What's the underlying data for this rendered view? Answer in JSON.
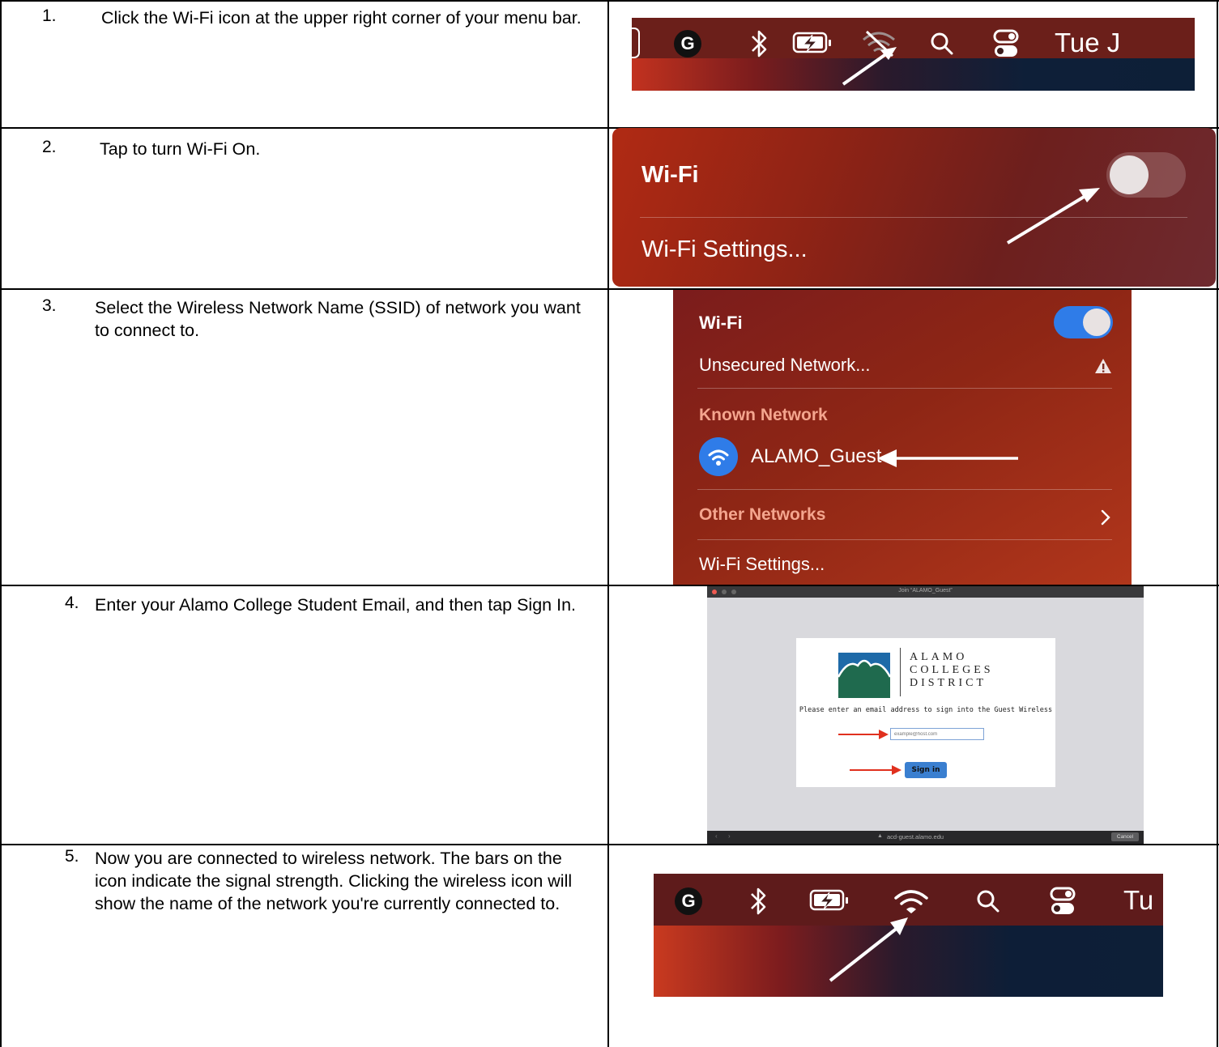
{
  "steps": [
    {
      "num": "1.",
      "text": "Click the Wi-Fi icon at the upper right corner of your menu bar."
    },
    {
      "num": "2.",
      "text": "Tap to turn Wi-Fi On."
    },
    {
      "num": "3.",
      "text": "Select the Wireless Network  Name (SSID) of network you want to connect to."
    },
    {
      "num": "4.",
      "text": "Enter your Alamo College Student Email, and then tap Sign In."
    },
    {
      "num": "5.",
      "text": "Now you are connected to wireless network.  The bars on the icon indicate the signal strength. Clicking the wireless icon will show the  name of the network you're currently connected to."
    }
  ],
  "menubar1": {
    "date_text": "Tue J",
    "icons": [
      "google-g-icon",
      "bluetooth-icon",
      "battery-charging-icon",
      "wifi-off-icon",
      "search-icon",
      "control-center-icon"
    ]
  },
  "panel2": {
    "wifi_label": "Wi-Fi",
    "settings_label": "Wi-Fi Settings...",
    "toggle_state": "off"
  },
  "panel3": {
    "wifi_label": "Wi-Fi",
    "unsecured_label": "Unsecured Network...",
    "known_header": "Known Network",
    "known_ssid": "ALAMO_Guest",
    "other_header": "Other Networks",
    "settings_label": "Wi-Fi Settings...",
    "toggle_state": "on",
    "accent_color": "#2f7ce8",
    "header_color": "#f4a58e"
  },
  "portal": {
    "window_title": "Join “ALAMO_Guest”",
    "logo_lines": [
      "ALAMO",
      "COLLEGES",
      "DISTRICT"
    ],
    "prompt": "Please enter an email address to sign into the Guest Wireless",
    "email_placeholder": "example@host.com",
    "sign_in_label": "Sign in",
    "url": "acd-guest.alamo.edu",
    "cancel_label": "Cancel",
    "button_color": "#3a7fd0",
    "arrow_color": "#e0301e"
  },
  "menubar5": {
    "date_text": "Tu",
    "icons": [
      "google-g-icon",
      "bluetooth-icon",
      "battery-charging-icon",
      "wifi-connected-icon",
      "search-icon",
      "control-center-icon"
    ]
  }
}
